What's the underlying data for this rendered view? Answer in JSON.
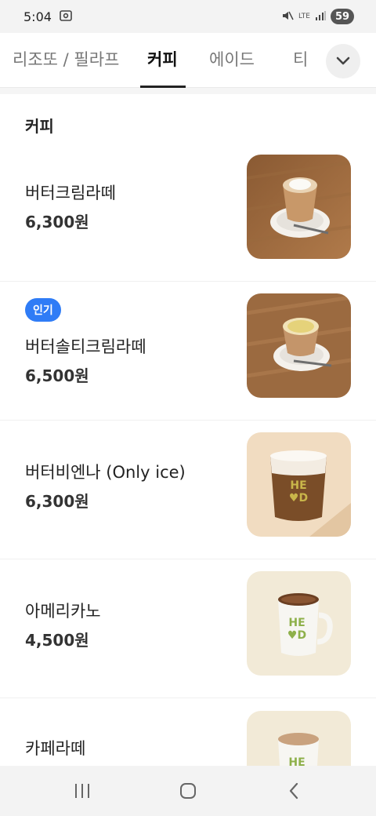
{
  "status_bar": {
    "time": "5:04",
    "network": "LTE",
    "battery": "59"
  },
  "tabs": [
    {
      "label": "리조또 / 필라프",
      "active": false
    },
    {
      "label": "커피",
      "active": true
    },
    {
      "label": "에이드",
      "active": false
    },
    {
      "label": "티",
      "active": false
    }
  ],
  "icons": {
    "tab_more": "chevron-down-icon",
    "nav_recent": "recent-apps-icon",
    "nav_home": "home-icon",
    "nav_back": "back-icon"
  },
  "section": {
    "title": "커피"
  },
  "menu": [
    {
      "name": "버터크림라떼",
      "price": "6,300원",
      "badge": "",
      "image": "butter-cream-latte-photo"
    },
    {
      "name": "버터솔티크림라떼",
      "price": "6,500원",
      "badge": "인기",
      "image": "butter-salty-cream-latte-photo"
    },
    {
      "name": "버터비엔나 (Only ice)",
      "price": "6,300원",
      "badge": "",
      "image": "butter-vienna-photo"
    },
    {
      "name": "아메리카노",
      "price": "4,500원",
      "badge": "",
      "image": "americano-photo"
    },
    {
      "name": "카페라떼",
      "price": "",
      "badge": "",
      "image": "cafe-latte-photo"
    }
  ],
  "colors": {
    "badge": "#2f7cf6",
    "active_tab": "#111111",
    "inactive_tab": "#777777"
  }
}
